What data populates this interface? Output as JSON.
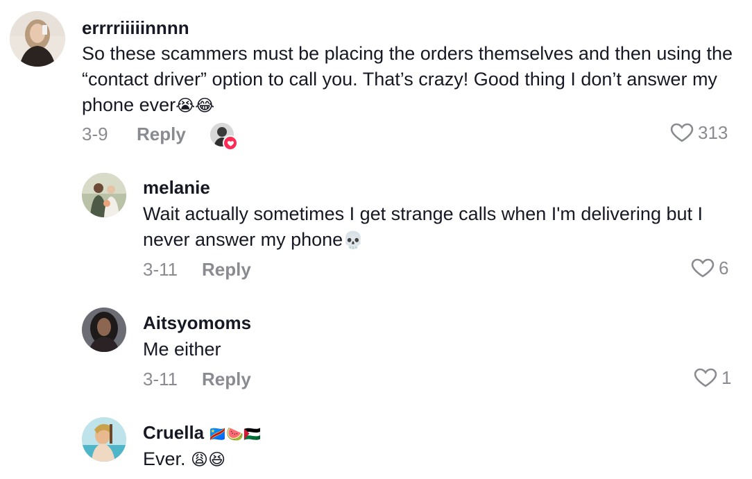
{
  "comments": [
    {
      "username": "errrriiiiinnnn",
      "text": "So these scammers must be placing the orders themselves and then using the “contact driver” option to call you. That’s crazy! Good thing I don’t answer my phone ever",
      "emojis": "😭😂",
      "date": "3-9",
      "reply_label": "Reply",
      "likes": "313"
    },
    {
      "username": "melanie",
      "text": "Wait actually sometimes I get strange calls when I'm delivering but I never answer my phone",
      "emojis": "💀",
      "date": "3-11",
      "reply_label": "Reply",
      "likes": "6"
    },
    {
      "username": "Aitsyomoms",
      "text": "Me either",
      "date": "3-11",
      "reply_label": "Reply",
      "likes": "1"
    },
    {
      "username": "Cruella",
      "username_emojis": "🇨🇩🍉🇵🇸",
      "text": "Ever.",
      "emojis": "😩😆"
    }
  ],
  "colors": {
    "text": "#161823",
    "secondary": "#8a8b91",
    "like_badge": "#fe2c55"
  }
}
